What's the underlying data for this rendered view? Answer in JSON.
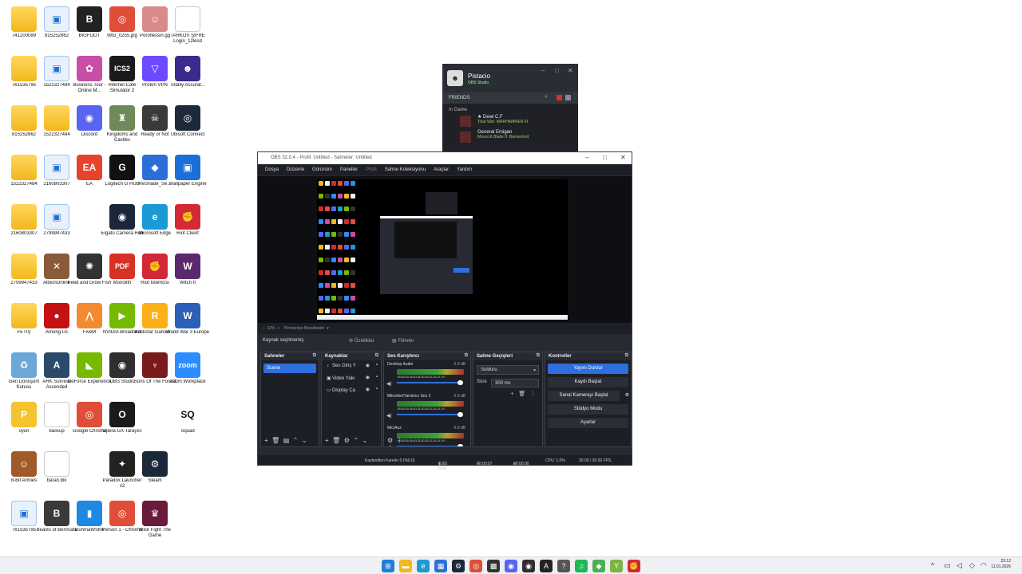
{
  "desktop": {
    "icons": [
      {
        "label": "741200089",
        "kind": "folder",
        "glyph": ""
      },
      {
        "label": "815252862",
        "kind": "blue",
        "glyph": "▣"
      },
      {
        "label": "BIGFOOT",
        "kind": "app",
        "glyph": "B",
        "color": "#222222"
      },
      {
        "label": "IMG_0255.jpg",
        "kind": "app",
        "glyph": "◎",
        "color": "#e04e39"
      },
      {
        "label": "Poroflessin.gg",
        "kind": "app",
        "glyph": "☺",
        "color": "#d98a8a"
      },
      {
        "label": "TARKOV ŞİFRE Login_12lesd",
        "kind": "file",
        "glyph": ""
      },
      {
        "label": "761535795",
        "kind": "folder",
        "glyph": ""
      },
      {
        "label": "1522327484",
        "kind": "blue",
        "glyph": "▣"
      },
      {
        "label": "Business Tour - Online M...",
        "kind": "app",
        "glyph": "✿",
        "color": "#c84fa6"
      },
      {
        "label": "Internet Cafe Simulator 2",
        "kind": "app",
        "glyph": "ICS2",
        "color": "#1b1b1b"
      },
      {
        "label": "Proton VPN",
        "kind": "app",
        "glyph": "▽",
        "color": "#6d4aff"
      },
      {
        "label": "Totally Accurat...",
        "kind": "app",
        "glyph": "☻",
        "color": "#3a2b8c"
      },
      {
        "label": "815252862",
        "kind": "folder",
        "glyph": ""
      },
      {
        "label": "1522327484",
        "kind": "folder",
        "glyph": ""
      },
      {
        "label": "Discord",
        "kind": "app",
        "glyph": "◉",
        "color": "#5865f2"
      },
      {
        "label": "Kingdoms and Castles",
        "kind": "app",
        "glyph": "♜",
        "color": "#6f8a5a"
      },
      {
        "label": "Ready or Not",
        "kind": "app",
        "glyph": "☠",
        "color": "#3a3a3a"
      },
      {
        "label": "Ubisoft Connect",
        "kind": "app",
        "glyph": "◎",
        "color": "#1d2a3a"
      },
      {
        "label": "1522327484",
        "kind": "folder",
        "glyph": ""
      },
      {
        "label": "2160803307",
        "kind": "blue",
        "glyph": "▣"
      },
      {
        "label": "EA",
        "kind": "app",
        "glyph": "EA",
        "color": "#e8432a"
      },
      {
        "label": "Logitech G HUB",
        "kind": "app",
        "glyph": "G",
        "color": "#111111"
      },
      {
        "label": "ReShade_Se...",
        "kind": "app",
        "glyph": "◆",
        "color": "#2b6fd6"
      },
      {
        "label": "Wallpaper Engine",
        "kind": "app",
        "glyph": "▣",
        "color": "#1c6fd8"
      },
      {
        "label": "2160803307",
        "kind": "folder",
        "glyph": ""
      },
      {
        "label": "2799947433",
        "kind": "blue",
        "glyph": "▣"
      },
      {
        "label": "Elgato Camera Hub",
        "kind": "app",
        "glyph": "◉",
        "color": "#1b2638"
      },
      {
        "label": "Microsoft Edge",
        "kind": "app",
        "glyph": "e",
        "color": "#1c9ad6"
      },
      {
        "label": "Riot Client",
        "kind": "app",
        "glyph": "✊",
        "color": "#d32936"
      },
      {
        "label": "2799947433",
        "kind": "folder",
        "glyph": ""
      },
      {
        "label": "AlbionOnline",
        "kind": "app",
        "glyph": "✕",
        "color": "#8a5a3a"
      },
      {
        "label": "Feed and Grow Fish",
        "kind": "app",
        "glyph": "✺",
        "color": "#333333"
      },
      {
        "label": "Monolith",
        "kind": "app",
        "glyph": "PDF",
        "color": "#d93025"
      },
      {
        "label": "Riot İstemcisi",
        "kind": "app",
        "glyph": "✊",
        "color": "#d32936"
      },
      {
        "label": "Witch It",
        "kind": "app",
        "glyph": "W",
        "color": "#5b2a6e"
      },
      {
        "label": "FETİŞ",
        "kind": "folder",
        "glyph": ""
      },
      {
        "label": "Among Us",
        "kind": "app",
        "glyph": "●",
        "color": "#c51111"
      },
      {
        "label": "FiveM",
        "kind": "app",
        "glyph": "⋀",
        "color": "#f28a30"
      },
      {
        "label": "NVIDIA Broadcast",
        "kind": "app",
        "glyph": "▶",
        "color": "#76b900"
      },
      {
        "label": "Rockstar Games ...",
        "kind": "app",
        "glyph": "R",
        "color": "#fcaf17"
      },
      {
        "label": "World War 3 Europe",
        "kind": "app",
        "glyph": "W",
        "color": "#2b5fb8"
      },
      {
        "label": "Geri Dönüşüm Kutusu",
        "kind": "app",
        "glyph": "♻",
        "color": "#6aa8d8"
      },
      {
        "label": "ARK Survival Ascended",
        "kind": "app",
        "glyph": "A",
        "color": "#2b4a6a"
      },
      {
        "label": "GeForce Experience",
        "kind": "app",
        "glyph": "◣",
        "color": "#76b900"
      },
      {
        "label": "OBS Studio",
        "kind": "app",
        "glyph": "◉",
        "color": "#302e31"
      },
      {
        "label": "Sons Of The Forest",
        "kind": "app",
        "glyph": "♆",
        "color": "#7a1a1a"
      },
      {
        "label": "Zoom Workplace",
        "kind": "app",
        "glyph": "zoom",
        "color": "#2d8cff"
      },
      {
        "label": "oyun",
        "kind": "app",
        "glyph": "P",
        "color": "#f4c430"
      },
      {
        "label": "backup",
        "kind": "file",
        "glyph": ""
      },
      {
        "label": "Google Chrome",
        "kind": "app",
        "glyph": "◎",
        "color": "#e04e39"
      },
      {
        "label": "Opera GX Tarayıcı",
        "kind": "app",
        "glyph": "O",
        "color": "#1a1a1a"
      },
      {
        "label": "Squad",
        "kind": "app",
        "glyph": "SQ",
        "color": "#ffffff"
      },
      {
        "label": "8-Bit Armies",
        "kind": "app",
        "glyph": "☺",
        "color": "#a05a2a"
      },
      {
        "label": "baran.blk",
        "kind": "file",
        "glyph": ""
      },
      {
        "label": "Paradox Launcher v2",
        "kind": "app",
        "glyph": "✦",
        "color": "#222222"
      },
      {
        "label": "Steam",
        "kind": "app",
        "glyph": "⚙",
        "color": "#1b2838"
      },
      {
        "label": "761535795",
        "kind": "blue",
        "glyph": "▣"
      },
      {
        "label": "Beasts of Bermuda",
        "kind": "app",
        "glyph": "B",
        "color": "#3a3a3a"
      },
      {
        "label": "GuhmaWSKh",
        "kind": "app",
        "glyph": "▮",
        "color": "#1e88e5"
      },
      {
        "label": "Person 1 - Chrome",
        "kind": "app",
        "glyph": "◎",
        "color": "#e04e39"
      },
      {
        "label": "Stick Fight The Game",
        "kind": "app",
        "glyph": "♛",
        "color": "#6a1a3a"
      }
    ]
  },
  "steam": {
    "user_name": "Pistacio",
    "user_status": "OBS Studio",
    "friends_header": "FRIENDS",
    "in_game_header": "In Game",
    "friends": [
      {
        "name": "★ Dewi C.F",
        "game": "Total War: WARHAMMER III"
      },
      {
        "name": "General Emigan",
        "game": "Mount & Blade II: Bannerlord"
      }
    ]
  },
  "obs": {
    "title": "OBS 32.0.4 - Profil: Untitled - Sahneler: Untitled",
    "menu": [
      "Dosya",
      "Düzenle",
      "Görünüm",
      "Paneller",
      "Profil",
      "Sahne Koleksiyonu",
      "Araçlar",
      "Yardım"
    ],
    "preview_toolbar": {
      "zoom": "32%",
      "fit": "Pencereye Boyutlandır"
    },
    "source_bar": {
      "no_source": "Kaynak seçilmemiş",
      "properties": "Özellikler",
      "filters": "Filtreler"
    },
    "scenes": {
      "title": "Sahneler",
      "items": [
        "Scene"
      ]
    },
    "sources": {
      "title": "Kaynaklar",
      "items": [
        "Ses Giriş Y",
        "Video Yakı",
        "Display Ca"
      ]
    },
    "mixer": {
      "title": "Ses Karıştırıcı",
      "ticks": "-60-55-50-45-40-35-30-25-20-15-10 -5 0",
      "channels": [
        {
          "name": "Desktop Audio",
          "db": "0.0 dB"
        },
        {
          "name": "Mikrofon/Yardımcı Ses 2",
          "db": "0.0 dB"
        },
        {
          "name": "Mic/Aux",
          "db": "0.0 dB"
        }
      ]
    },
    "transitions": {
      "title": "Sahne Geçişleri",
      "selected": "Solduru",
      "duration_label": "Süre",
      "duration": "300 ms"
    },
    "controls": {
      "title": "Kontroller",
      "buttons": [
        "Yayını Durdur",
        "Kaydı Başlat",
        "Sanal Kamerayı Başlat",
        "Stüdyo Modu",
        "Ayarlar"
      ]
    },
    "status": {
      "dropped": "Kaybedilen Kareler 0 (%0.0)",
      "bitrate": "6165 kbps",
      "live_time": "00:00:07",
      "rec_time": "00:00:00",
      "cpu": "CPU: 1.0%",
      "fps": "30.00 / 30.00 FPS"
    }
  },
  "taskbar": {
    "time": "23:12",
    "date": "11.01.2026"
  },
  "colors": {
    "accent": "#2f6fdd",
    "obs_bg": "#272a33",
    "obs_dock": "#1d1f26"
  }
}
